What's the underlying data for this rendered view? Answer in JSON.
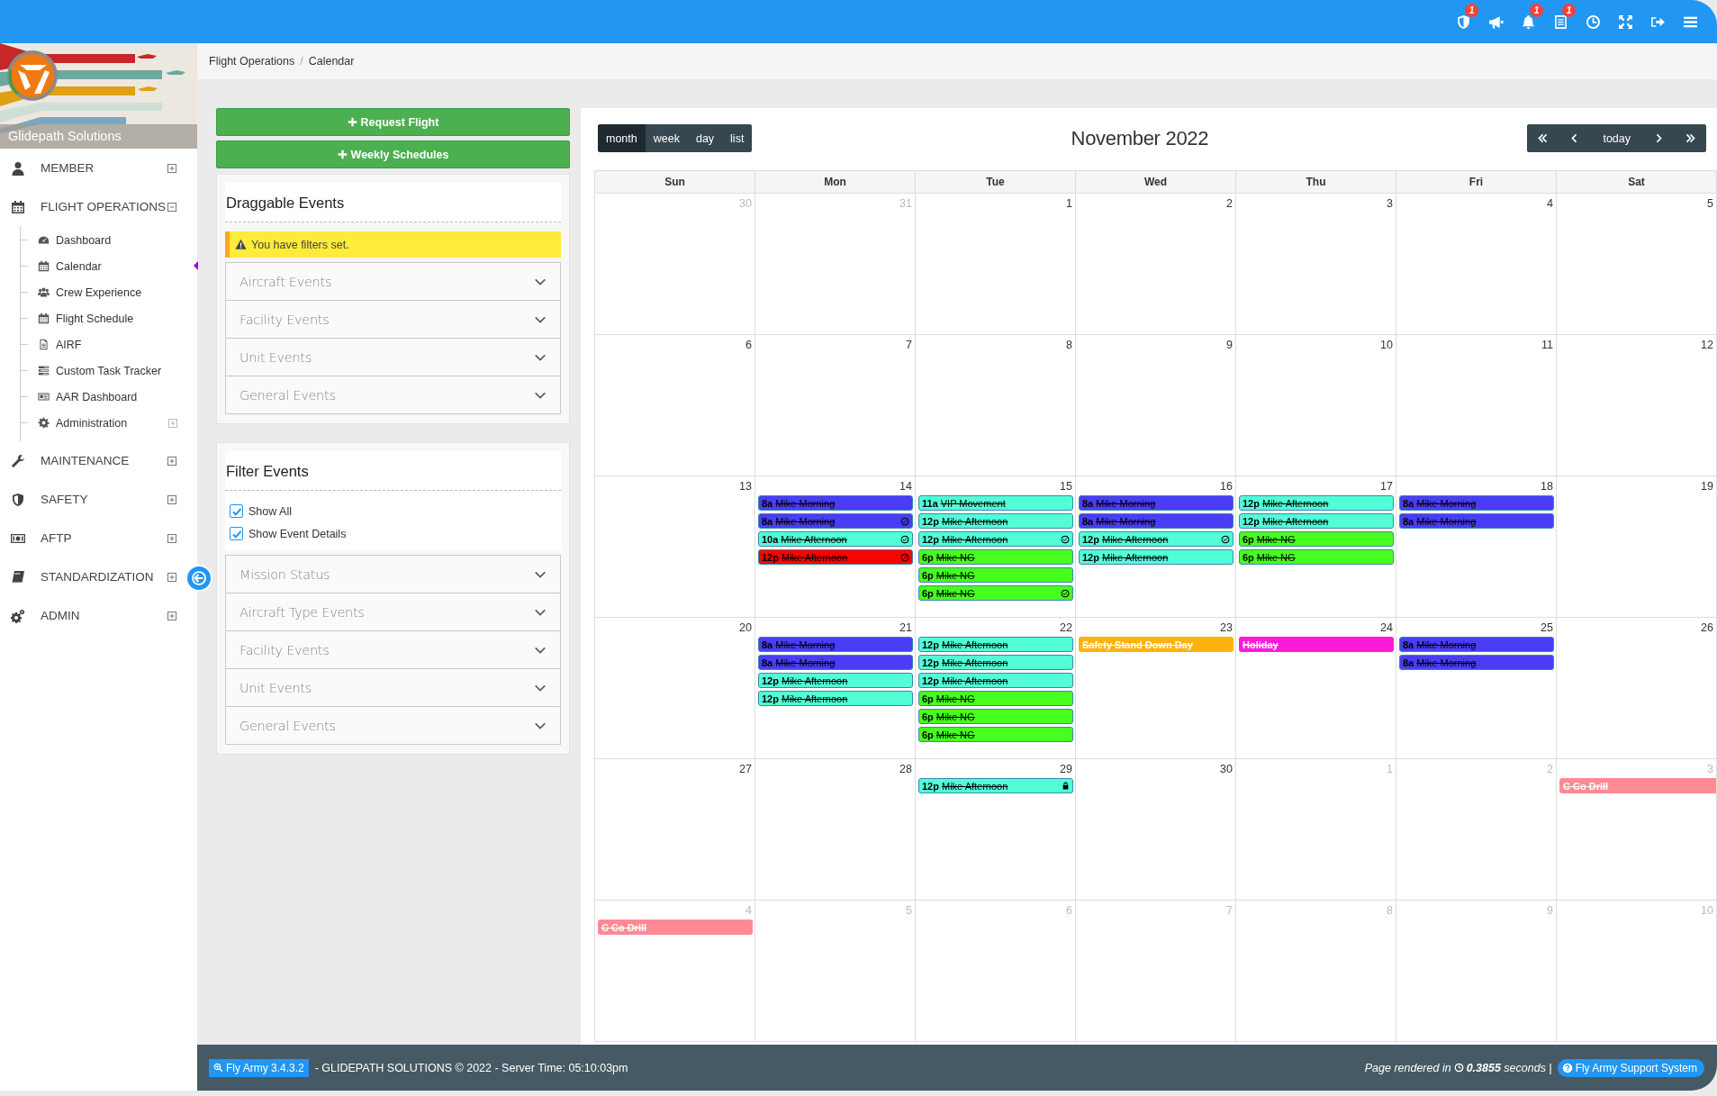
{
  "top_bar": {
    "icons": [
      {
        "kind": "shield",
        "badge": "1"
      },
      {
        "kind": "megaphone"
      },
      {
        "kind": "bell",
        "badge": "1"
      },
      {
        "kind": "document",
        "badge": "1"
      },
      {
        "kind": "clock"
      },
      {
        "kind": "expand"
      },
      {
        "kind": "signout"
      },
      {
        "kind": "menu"
      }
    ]
  },
  "sidebar": {
    "brand": "Glidepath Solutions",
    "items": [
      {
        "kind": "user",
        "label": "MEMBER",
        "expanded": false
      },
      {
        "kind": "calendar",
        "label": "FLIGHT OPERATIONS",
        "expanded": true,
        "children": [
          {
            "kind": "gauge",
            "label": "Dashboard",
            "selected": false
          },
          {
            "kind": "calendar",
            "label": "Calendar",
            "selected": true
          },
          {
            "kind": "users",
            "label": "Crew Experience",
            "selected": false
          },
          {
            "kind": "calendar",
            "label": "Flight Schedule",
            "selected": false
          },
          {
            "kind": "file",
            "label": "AIRF",
            "selected": false
          },
          {
            "kind": "tasks",
            "label": "Custom Task Tracker",
            "selected": false
          },
          {
            "kind": "card",
            "label": "AAR Dashboard",
            "selected": false
          },
          {
            "kind": "gear",
            "label": "Administration",
            "selected": false,
            "expandable": true
          }
        ]
      },
      {
        "kind": "wrench",
        "label": "MAINTENANCE",
        "expanded": false
      },
      {
        "kind": "shield",
        "label": "SAFETY",
        "expanded": false
      },
      {
        "kind": "money",
        "label": "AFTP",
        "expanded": false
      },
      {
        "kind": "book",
        "label": "STANDARDIZATION",
        "expanded": false
      },
      {
        "kind": "gears",
        "label": "ADMIN",
        "expanded": false
      }
    ]
  },
  "breadcrumb": {
    "items": [
      "Flight Operations",
      "Calendar"
    ],
    "separator": "/"
  },
  "actions": [
    "Request Flight",
    "Weekly Schedules"
  ],
  "draggable_events": {
    "title": "Draggable Events",
    "alert": "You have filters set.",
    "sections": [
      "Aircraft Events",
      "Facility Events",
      "Unit Events",
      "General Events"
    ]
  },
  "filter_events": {
    "title": "Filter Events",
    "checkboxes": [
      {
        "label": "Show All",
        "checked": true
      },
      {
        "label": "Show Event Details",
        "checked": true
      }
    ],
    "sections": [
      "Mission Status",
      "Aircraft Type Events",
      "Facility Events",
      "Unit Events",
      "General Events"
    ]
  },
  "calendar": {
    "title": "November 2022",
    "views": [
      {
        "label": "month",
        "selected": true
      },
      {
        "label": "week",
        "selected": false
      },
      {
        "label": "day",
        "selected": false
      },
      {
        "label": "list",
        "selected": false
      }
    ],
    "today": "today",
    "weekdays": [
      "Sun",
      "Mon",
      "Tue",
      "Wed",
      "Thu",
      "Fri",
      "Sat"
    ],
    "weeks": [
      {
        "days": [
          {
            "date": "30",
            "other_month": true
          },
          {
            "date": "31",
            "other_month": true
          },
          {
            "date": "1",
            "other_month": false
          },
          {
            "date": "2",
            "other_month": false
          },
          {
            "date": "3",
            "other_month": false
          },
          {
            "date": "4",
            "other_month": false
          },
          {
            "date": "5",
            "other_month": false
          }
        ]
      },
      {
        "days": [
          {
            "date": "6",
            "other_month": false
          },
          {
            "date": "7",
            "other_month": false
          },
          {
            "date": "8",
            "other_month": false
          },
          {
            "date": "9",
            "other_month": false
          },
          {
            "date": "10",
            "other_month": false
          },
          {
            "date": "11",
            "other_month": false
          },
          {
            "date": "12",
            "other_month": false
          }
        ]
      },
      {
        "days": [
          {
            "date": "13",
            "other_month": false
          },
          {
            "date": "14",
            "other_month": false,
            "events": [
              {
                "kind": "timed",
                "time": "8a",
                "title": "Mike Morning",
                "color": "#4a3df5",
                "approved": false,
                "cancelled": false,
                "locked": false
              },
              {
                "kind": "timed",
                "time": "8a",
                "title": "Mike Morning",
                "color": "#4a3df5",
                "approved": true,
                "cancelled": false,
                "locked": false
              },
              {
                "kind": "timed",
                "time": "10a",
                "title": "Mike Afternoon",
                "color": "#52ffd6",
                "approved": true,
                "cancelled": false,
                "locked": false
              },
              {
                "kind": "timed",
                "time": "12p",
                "title": "Mike Afternoon",
                "color": "#ff0000",
                "approved": false,
                "cancelled": true,
                "locked": false
              }
            ]
          },
          {
            "date": "15",
            "other_month": false,
            "events": [
              {
                "kind": "timed",
                "time": "11a",
                "title": "VIP Movement",
                "color": "#52ffd6",
                "approved": false,
                "cancelled": false,
                "locked": false
              },
              {
                "kind": "timed",
                "time": "12p",
                "title": "Mike Afternoon",
                "color": "#52ffd6",
                "approved": false,
                "cancelled": false,
                "locked": false
              },
              {
                "kind": "timed",
                "time": "12p",
                "title": "Mike Afternoon",
                "color": "#52ffd6",
                "approved": true,
                "cancelled": false,
                "locked": false
              },
              {
                "kind": "timed",
                "time": "6p",
                "title": "Mike NG",
                "color": "#47ff1f",
                "approved": false,
                "cancelled": false,
                "locked": false
              },
              {
                "kind": "timed",
                "time": "6p",
                "title": "Mike NG",
                "color": "#47ff1f",
                "approved": false,
                "cancelled": false,
                "locked": false
              },
              {
                "kind": "timed",
                "time": "6p",
                "title": "Mike NG",
                "color": "#47ff1f",
                "approved": true,
                "cancelled": false,
                "locked": false
              }
            ]
          },
          {
            "date": "16",
            "other_month": false,
            "events": [
              {
                "kind": "timed",
                "time": "8a",
                "title": "Mike Morning",
                "color": "#4a3df5",
                "approved": false,
                "cancelled": false,
                "locked": false
              },
              {
                "kind": "timed",
                "time": "8a",
                "title": "Mike Morning",
                "color": "#4a3df5",
                "approved": false,
                "cancelled": false,
                "locked": false
              },
              {
                "kind": "timed",
                "time": "12p",
                "title": "Mike Afternoon",
                "color": "#52ffd6",
                "approved": true,
                "cancelled": false,
                "locked": false
              },
              {
                "kind": "timed",
                "time": "12p",
                "title": "Mike Afternoon",
                "color": "#52ffd6",
                "approved": false,
                "cancelled": false,
                "locked": false
              }
            ]
          },
          {
            "date": "17",
            "other_month": false,
            "events": [
              {
                "kind": "timed",
                "time": "12p",
                "title": "Mike Afternoon",
                "color": "#52ffd6",
                "approved": false,
                "cancelled": false,
                "locked": false
              },
              {
                "kind": "timed",
                "time": "12p",
                "title": "Mike Afternoon",
                "color": "#52ffd6",
                "approved": false,
                "cancelled": false,
                "locked": false
              },
              {
                "kind": "timed",
                "time": "6p",
                "title": "Mike NG",
                "color": "#47ff1f",
                "approved": false,
                "cancelled": false,
                "locked": false
              },
              {
                "kind": "timed",
                "time": "6p",
                "title": "Mike NG",
                "color": "#47ff1f",
                "approved": false,
                "cancelled": false,
                "locked": false
              }
            ]
          },
          {
            "date": "18",
            "other_month": false,
            "events": [
              {
                "kind": "timed",
                "time": "8a",
                "title": "Mike Morning",
                "color": "#4a3df5",
                "approved": false,
                "cancelled": false,
                "locked": false
              },
              {
                "kind": "timed",
                "time": "8a",
                "title": "Mike Morning",
                "color": "#4a3df5",
                "approved": false,
                "cancelled": false,
                "locked": false
              }
            ]
          },
          {
            "date": "19",
            "other_month": false
          }
        ]
      },
      {
        "days": [
          {
            "date": "20",
            "other_month": false
          },
          {
            "date": "21",
            "other_month": false,
            "events": [
              {
                "kind": "timed",
                "time": "8a",
                "title": "Mike Morning",
                "color": "#4a3df5",
                "approved": false,
                "cancelled": false,
                "locked": false
              },
              {
                "kind": "timed",
                "time": "8a",
                "title": "Mike Morning",
                "color": "#4a3df5",
                "approved": false,
                "cancelled": false,
                "locked": false
              },
              {
                "kind": "timed",
                "time": "12p",
                "title": "Mike Afternoon",
                "color": "#52ffd6",
                "approved": false,
                "cancelled": false,
                "locked": false
              },
              {
                "kind": "timed",
                "time": "12p",
                "title": "Mike Afternoon",
                "color": "#52ffd6",
                "approved": false,
                "cancelled": false,
                "locked": false
              }
            ]
          },
          {
            "date": "22",
            "other_month": false,
            "events": [
              {
                "kind": "timed",
                "time": "12p",
                "title": "Mike Afternoon",
                "color": "#52ffd6",
                "approved": false,
                "cancelled": false,
                "locked": false
              },
              {
                "kind": "timed",
                "time": "12p",
                "title": "Mike Afternoon",
                "color": "#52ffd6",
                "approved": false,
                "cancelled": false,
                "locked": false
              },
              {
                "kind": "timed",
                "time": "12p",
                "title": "Mike Afternoon",
                "color": "#52ffd6",
                "approved": false,
                "cancelled": false,
                "locked": false
              },
              {
                "kind": "timed",
                "time": "6p",
                "title": "Mike NG",
                "color": "#47ff1f",
                "approved": false,
                "cancelled": false,
                "locked": false
              },
              {
                "kind": "timed",
                "time": "6p",
                "title": "Mike NG",
                "color": "#47ff1f",
                "approved": false,
                "cancelled": false,
                "locked": false
              },
              {
                "kind": "timed",
                "time": "6p",
                "title": "Mike NG",
                "color": "#47ff1f",
                "approved": false,
                "cancelled": false,
                "locked": false
              }
            ]
          },
          {
            "date": "23",
            "other_month": false,
            "events": [
              {
                "kind": "allday",
                "title": "Safety Stand Down Day",
                "color": "#ffb20f",
                "continues": false
              }
            ]
          },
          {
            "date": "24",
            "other_month": false,
            "events": [
              {
                "kind": "allday",
                "title": "Holiday",
                "color": "#ff1ad9",
                "continues": false
              }
            ]
          },
          {
            "date": "25",
            "other_month": false,
            "events": [
              {
                "kind": "timed",
                "time": "8a",
                "title": "Mike Morning",
                "color": "#4a3df5",
                "approved": false,
                "cancelled": false,
                "locked": false
              },
              {
                "kind": "timed",
                "time": "8a",
                "title": "Mike Morning",
                "color": "#4a3df5",
                "approved": false,
                "cancelled": false,
                "locked": false
              }
            ]
          },
          {
            "date": "26",
            "other_month": false
          }
        ]
      },
      {
        "days": [
          {
            "date": "27",
            "other_month": false
          },
          {
            "date": "28",
            "other_month": false
          },
          {
            "date": "29",
            "other_month": false,
            "events": [
              {
                "kind": "timed",
                "time": "12p",
                "title": "Mike Afternoon",
                "color": "#52ffd6",
                "approved": false,
                "cancelled": false,
                "locked": true
              }
            ]
          },
          {
            "date": "30",
            "other_month": false
          },
          {
            "date": "1",
            "other_month": true
          },
          {
            "date": "2",
            "other_month": true
          },
          {
            "date": "3",
            "other_month": true,
            "events": [
              {
                "kind": "allday",
                "title": "C Co Drill",
                "color": "#ff8a94",
                "continues": true
              }
            ]
          }
        ]
      },
      {
        "days": [
          {
            "date": "4",
            "other_month": true,
            "events": [
              {
                "kind": "allday",
                "title": "C Co Drill",
                "color": "#ff8a94",
                "continues": false
              }
            ]
          },
          {
            "date": "5",
            "other_month": true
          },
          {
            "date": "6",
            "other_month": true
          },
          {
            "date": "7",
            "other_month": true
          },
          {
            "date": "8",
            "other_month": true
          },
          {
            "date": "9",
            "other_month": true
          },
          {
            "date": "10",
            "other_month": true
          }
        ]
      }
    ]
  },
  "footer": {
    "version": "Fly Army 3.4.3.2",
    "text": "- GLIDEPATH SOLUTIONS © 2022 - Server Time: 05:10:03pm",
    "render_prefix": "Page rendered in",
    "render_time": "**0.3855** seconds |",
    "support": "Fly Army Support System"
  }
}
